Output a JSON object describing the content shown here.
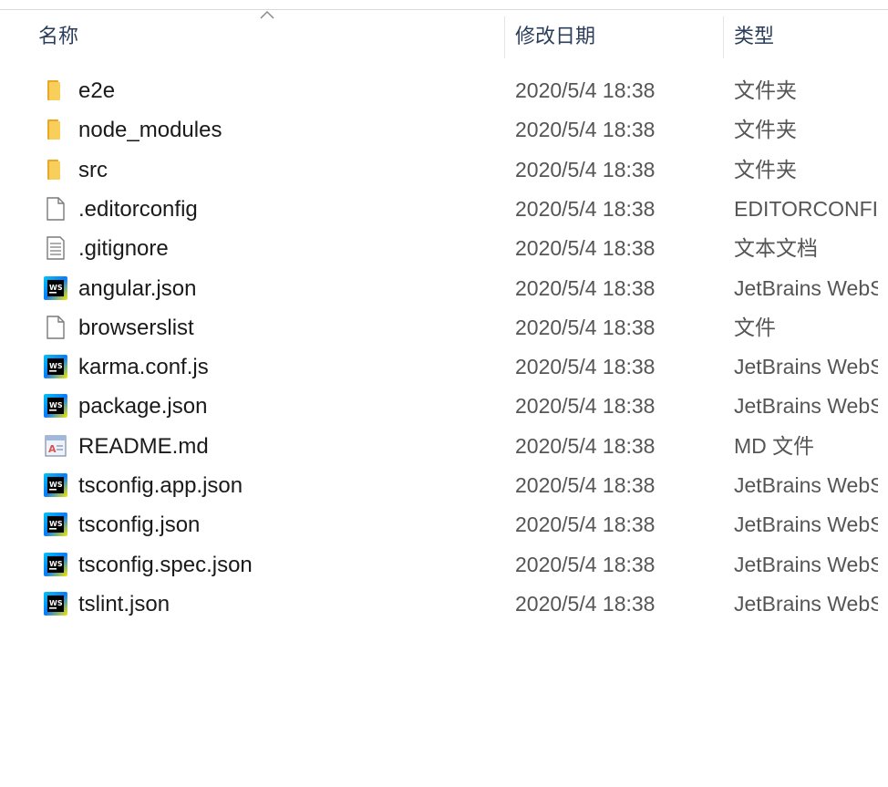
{
  "columns": {
    "name": "名称",
    "date": "修改日期",
    "type": "类型"
  },
  "files": [
    {
      "name": "e2e",
      "date": "2020/5/4 18:38",
      "type": "文件夹",
      "icon": "folder-icon"
    },
    {
      "name": "node_modules",
      "date": "2020/5/4 18:38",
      "type": "文件夹",
      "icon": "folder-icon"
    },
    {
      "name": "src",
      "date": "2020/5/4 18:38",
      "type": "文件夹",
      "icon": "folder-icon"
    },
    {
      "name": ".editorconfig",
      "date": "2020/5/4 18:38",
      "type": "EDITORCONFIG",
      "icon": "blank-file-icon"
    },
    {
      "name": ".gitignore",
      "date": "2020/5/4 18:38",
      "type": "文本文档",
      "icon": "text-file-icon"
    },
    {
      "name": "angular.json",
      "date": "2020/5/4 18:38",
      "type": "JetBrains WebStorm",
      "icon": "webstorm-file-icon"
    },
    {
      "name": "browserslist",
      "date": "2020/5/4 18:38",
      "type": "文件",
      "icon": "blank-file-icon"
    },
    {
      "name": "karma.conf.js",
      "date": "2020/5/4 18:38",
      "type": "JetBrains WebStorm",
      "icon": "webstorm-file-icon"
    },
    {
      "name": "package.json",
      "date": "2020/5/4 18:38",
      "type": "JetBrains WebStorm",
      "icon": "webstorm-file-icon"
    },
    {
      "name": "README.md",
      "date": "2020/5/4 18:38",
      "type": "MD 文件",
      "icon": "markdown-file-icon"
    },
    {
      "name": "tsconfig.app.json",
      "date": "2020/5/4 18:38",
      "type": "JetBrains WebStorm",
      "icon": "webstorm-file-icon"
    },
    {
      "name": "tsconfig.json",
      "date": "2020/5/4 18:38",
      "type": "JetBrains WebStorm",
      "icon": "webstorm-file-icon"
    },
    {
      "name": "tsconfig.spec.json",
      "date": "2020/5/4 18:38",
      "type": "JetBrains WebStorm",
      "icon": "webstorm-file-icon"
    },
    {
      "name": "tslint.json",
      "date": "2020/5/4 18:38",
      "type": "JetBrains WebStorm",
      "icon": "webstorm-file-icon"
    }
  ],
  "colors": {
    "folder": "#f2c14e",
    "header_text": "#2b3e5a"
  }
}
